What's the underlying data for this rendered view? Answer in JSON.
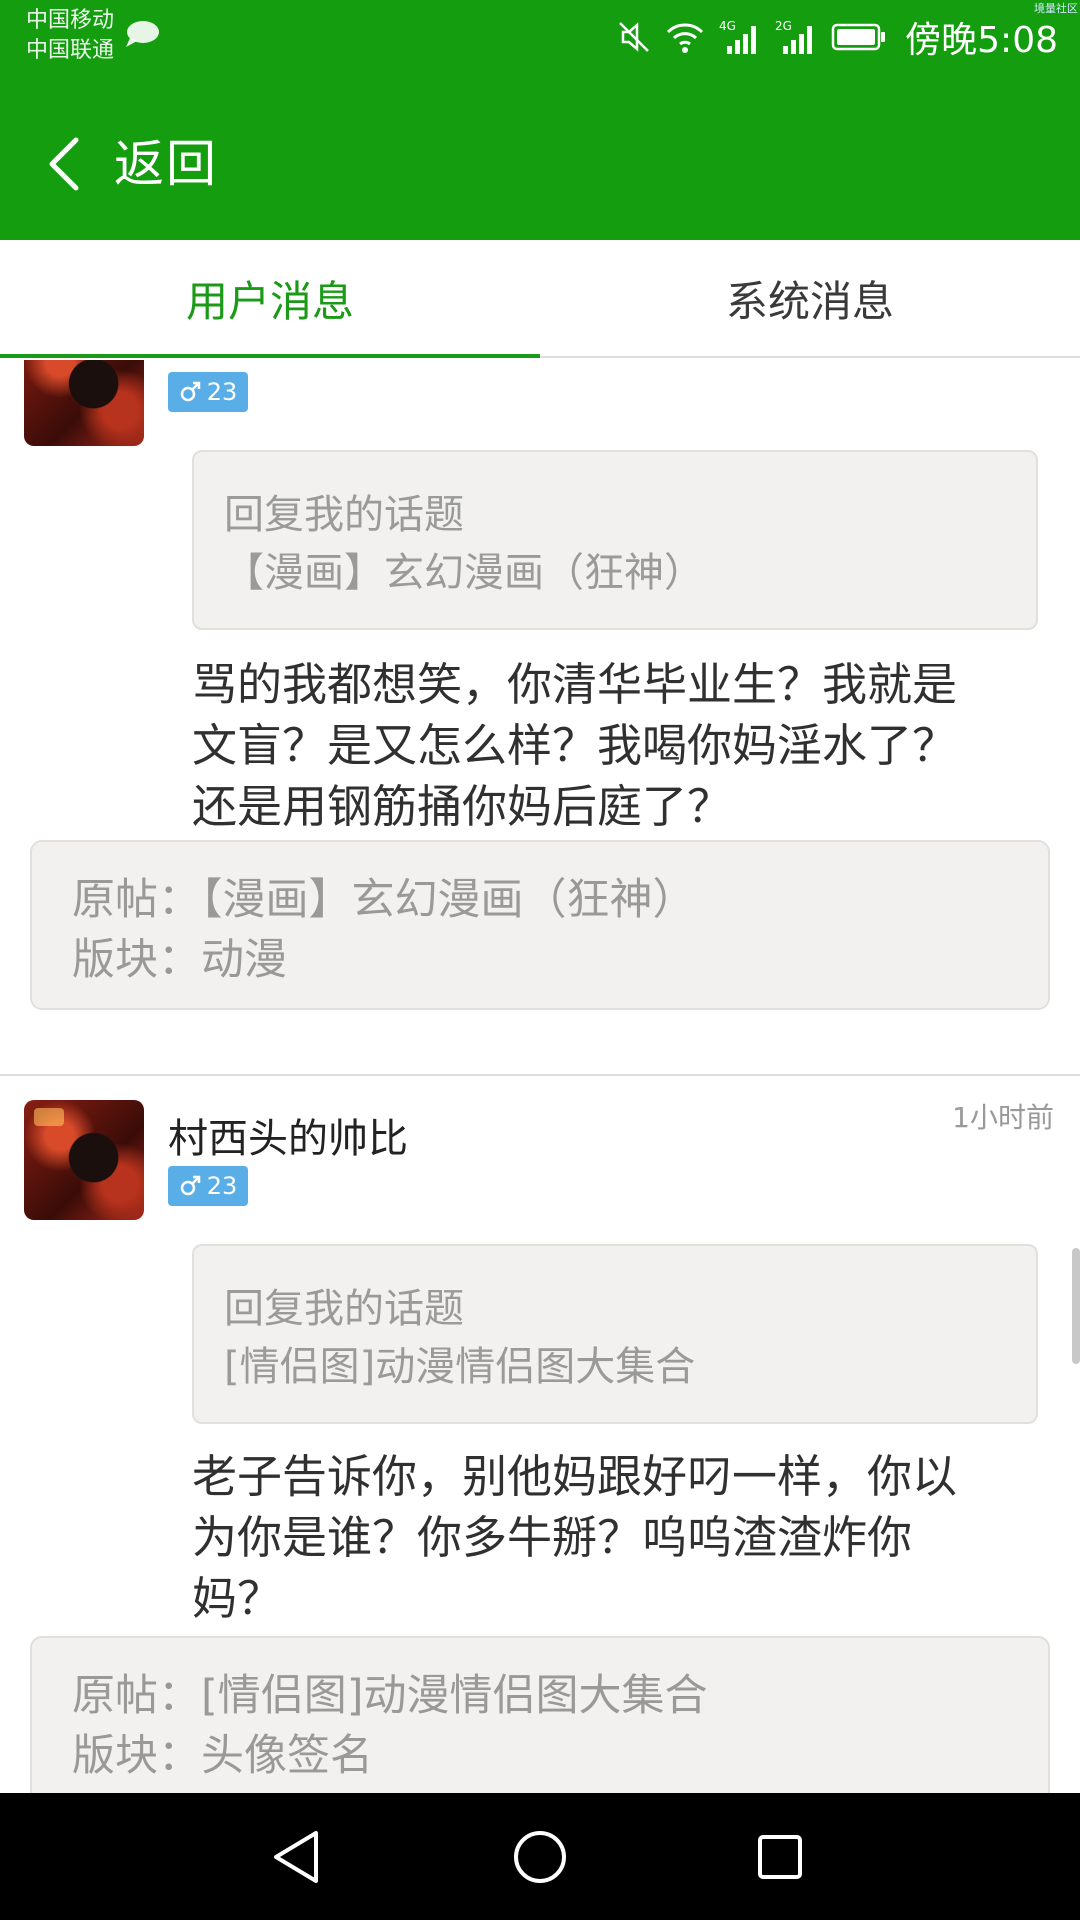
{
  "status_bar": {
    "carrier_1": "中国移动",
    "carrier_2": "中国联通",
    "network_1": "4G",
    "network_2": "2G",
    "time": "傍晚5:08",
    "corner_tag": "境量社区",
    "icons": [
      "chat-bubble-icon",
      "mute-icon",
      "wifi-icon",
      "signal-icon",
      "battery-icon"
    ]
  },
  "header": {
    "back_label": "返回"
  },
  "tabs": [
    {
      "label": "用户消息",
      "active": true
    },
    {
      "label": "系统消息",
      "active": false
    }
  ],
  "messages": [
    {
      "username": "",
      "gender_symbol": "♂",
      "age": "23",
      "time": "",
      "quote_line_1": "回复我的话题",
      "quote_line_2": "【漫画】玄幻漫画（狂神）",
      "content_lines": [
        "骂的我都想笑，你清华毕业生？我就是",
        "文盲？是又怎么样？我喝你妈淫水了？",
        "还是用钢筋捅你妈后庭了？"
      ],
      "origin_line": "原帖：【漫画】玄幻漫画（狂神）",
      "board_line": "版块：动漫"
    },
    {
      "username": "村西头的帅比",
      "gender_symbol": "♂",
      "age": "23",
      "time": "1小时前",
      "quote_line_1": "回复我的话题",
      "quote_line_2": "[情侣图]动漫情侣图大集合",
      "content_lines": [
        "老子告诉你，别他妈跟好叼一样，你以",
        "为你是谁？你多牛掰？呜呜渣渣炸你",
        "妈？"
      ],
      "origin_line": "原帖：[情侣图]动漫情侣图大集合",
      "board_line": "版块：头像签名"
    }
  ],
  "colors": {
    "brand_green": "#139d0f",
    "tab_active": "#1a9a16",
    "badge_blue": "#5aaee8",
    "card_bg": "#f2f1f0"
  },
  "nav": {
    "icons": [
      "back-triangle-icon",
      "home-circle-icon",
      "recents-square-icon"
    ]
  }
}
